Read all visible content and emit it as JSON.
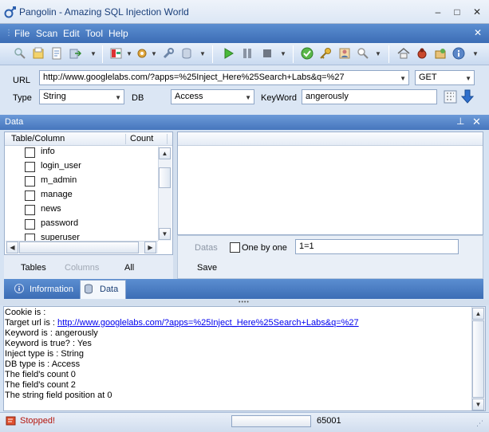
{
  "window": {
    "title": "Pangolin - Amazing SQL Injection World",
    "minimize_glyph": "–",
    "maximize_glyph": "□",
    "close_glyph": "✕"
  },
  "menu": {
    "items": [
      "File",
      "Scan",
      "Edit",
      "Tool",
      "Help"
    ],
    "close_glyph": "✕"
  },
  "toolbar": {
    "icons": [
      "search-icon",
      "open-icon",
      "save-icon",
      "export-icon",
      "bookmark-icon",
      "settings-icon",
      "wrench-icon",
      "database-icon",
      "play-icon",
      "pause-icon",
      "stop-icon",
      "check-icon",
      "key-icon",
      "user-icon",
      "find-icon",
      "home-icon",
      "bug-icon",
      "package-icon",
      "info-icon"
    ]
  },
  "form": {
    "url_label": "URL",
    "url_value": "http://www.googlelabs.com/?apps=%25Inject_Here%25Search+Labs&q=%27",
    "method_value": "GET",
    "type_label": "Type",
    "type_value": "String",
    "db_label": "DB",
    "db_value": "Access",
    "keyword_label": "KeyWord",
    "keyword_value": "angerously"
  },
  "data_panel": {
    "title": "Data",
    "pin_glyph": "ᵖ",
    "close_glyph": "✕",
    "col_table": "Table/Column",
    "col_count": "Count",
    "tables": [
      "info",
      "login_user",
      "m_admin",
      "manage",
      "news",
      "password",
      "superuser"
    ],
    "tab_tables": "Tables",
    "tab_columns": "Columns",
    "tab_all": "All",
    "datas_label": "Datas",
    "one_by_one_label": "One by one",
    "filter_value": "1=1",
    "save_label": "Save"
  },
  "tabs": {
    "information": "Information",
    "data": "Data"
  },
  "log": {
    "cookie": "Cookie is :",
    "target_prefix": "Target url is : ",
    "target_url": "http://www.googlelabs.com/?apps=%25Inject_Here%25Search+Labs&q=%27",
    "keyword": "Keyword is : angerously",
    "keyword_true": "Keyword is true? : Yes",
    "inject_type": "Inject type is : String",
    "db_type": "DB type is : Access",
    "field_count_0": "The field's count 0",
    "field_count_2": "The field's count 2",
    "string_pos": "The string field position at 0"
  },
  "status": {
    "text": "Stopped!",
    "code": "65001"
  },
  "colors": {
    "menubar": "#3c6db5",
    "stopped": "#b4150c",
    "link": "#0000ee"
  }
}
